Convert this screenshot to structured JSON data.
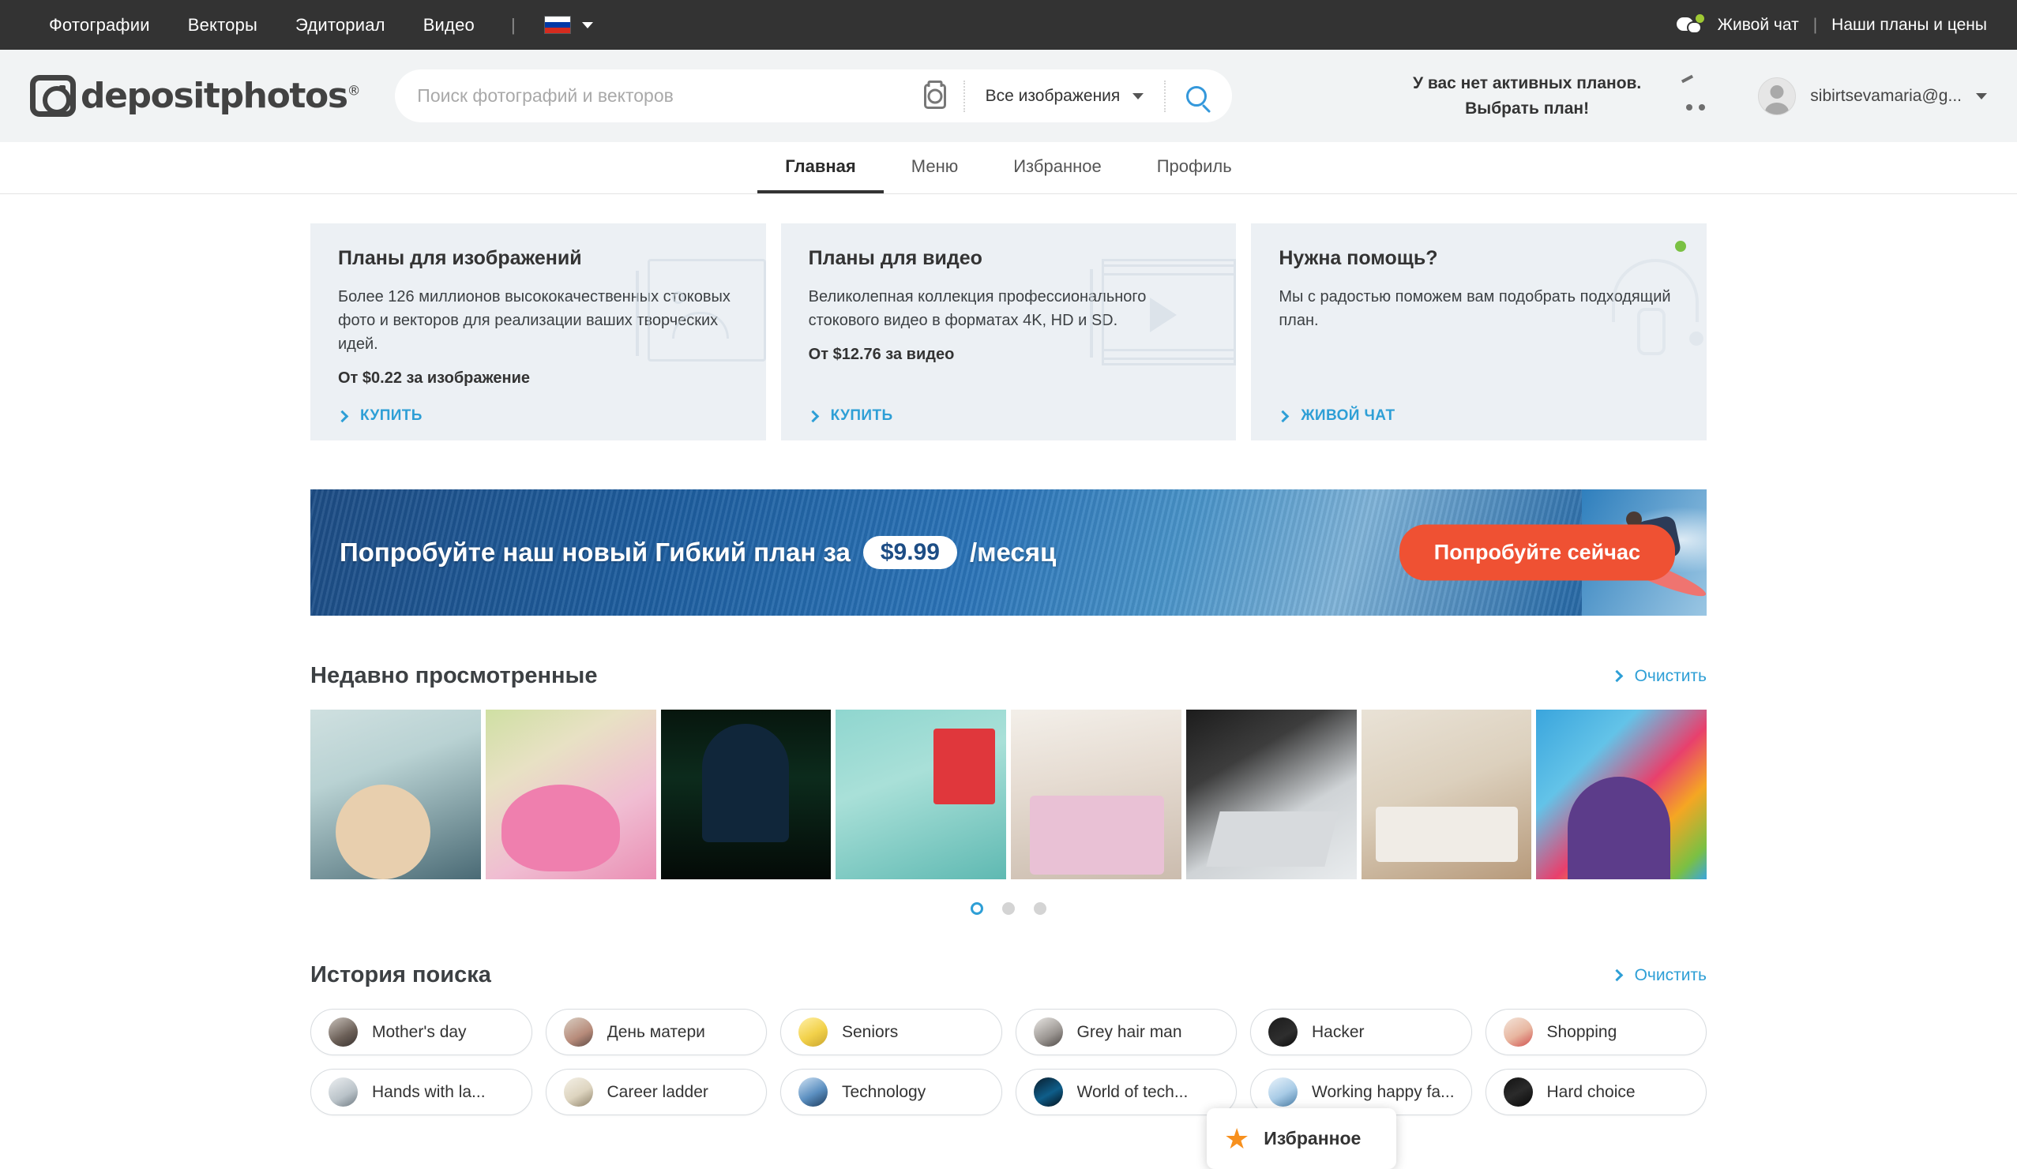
{
  "topbar": {
    "links": [
      "Фотографии",
      "Векторы",
      "Эдиториал",
      "Видео"
    ],
    "separator": "|",
    "language_flag": "russia-flag-icon",
    "live_chat": "Живой чат",
    "right_separator": "|",
    "plans_link": "Наши планы и цены"
  },
  "header": {
    "logo_text": "depositphotos",
    "logo_reg": "®",
    "search": {
      "placeholder": "Поиск фотографий и векторов",
      "value": "",
      "camera_icon": "camera-search-icon",
      "filter_selected": "Все изображения",
      "search_icon": "search-icon"
    },
    "plans_line1": "У вас нет активных планов.",
    "plans_line2": "Выбрать план!",
    "cart_icon": "cart-icon",
    "user_email": "sibirtsevamaria@g...",
    "user_caret": "chevron-down-icon"
  },
  "tabs": [
    {
      "label": "Главная",
      "active": true
    },
    {
      "label": "Меню",
      "active": false
    },
    {
      "label": "Избранное",
      "active": false
    },
    {
      "label": "Профиль",
      "active": false
    }
  ],
  "cards": [
    {
      "title": "Планы для изображений",
      "text": "Более 126 миллионов высококачественных стоковых фото и векторов для реализации ваших творческих идей.",
      "price": "От $0.22 за изображение",
      "cta": "КУПИТЬ",
      "art": "image-placeholder-icon"
    },
    {
      "title": "Планы для видео",
      "text": "Великолепная коллекция профессионального стокового видео в форматах 4K, HD и SD.",
      "price": "От $12.76 за видео",
      "cta": "КУПИТЬ",
      "art": "film-strip-icon"
    },
    {
      "title": "Нужна помощь?",
      "text": "Мы с радостью поможем вам подобрать подходящий план.",
      "price": "",
      "cta": "ЖИВОЙ ЧАТ",
      "art": "headset-icon"
    }
  ],
  "banner": {
    "text_before": "Попробуйте наш новый Гибкий план за",
    "price": "$9.99",
    "text_after": "/месяц",
    "button": "Попробуйте сейчас",
    "accent_color": "#ef5133"
  },
  "recently_viewed": {
    "title": "Недавно просмотренные",
    "clear": "Очистить",
    "thumbs": [
      "senior-couple-smiling",
      "seniors-group-laughing",
      "hacker-hooded-figure",
      "hands-holding-tablet-shoe-sale",
      "women-with-shopping-bags",
      "hands-on-laptop-desk",
      "hands-typing-keyboard",
      "colorful-powder-portrait"
    ],
    "dots": [
      true,
      false,
      false
    ]
  },
  "search_history": {
    "title": "История поиска",
    "clear": "Очистить",
    "rows": [
      [
        {
          "label": "Mother's day",
          "avatar": "a1"
        },
        {
          "label": "День матери",
          "avatar": "a2"
        },
        {
          "label": "Seniors",
          "avatar": "a3"
        },
        {
          "label": "Grey hair man",
          "avatar": "a4"
        },
        {
          "label": "Hacker",
          "avatar": "a5"
        },
        {
          "label": "Shopping",
          "avatar": "a6"
        }
      ],
      [
        {
          "label": "Hands with la...",
          "avatar": "a7"
        },
        {
          "label": "Career ladder",
          "avatar": "a8"
        },
        {
          "label": "Technology",
          "avatar": "a9"
        },
        {
          "label": "World of tech...",
          "avatar": "a10"
        },
        {
          "label": "Working happy fa...",
          "avatar": "a11"
        },
        {
          "label": "Hard choice",
          "avatar": "a12"
        }
      ]
    ]
  },
  "tooltip": {
    "label": "Избранное",
    "icon": "star-icon",
    "icon_color": "#f7901e"
  }
}
